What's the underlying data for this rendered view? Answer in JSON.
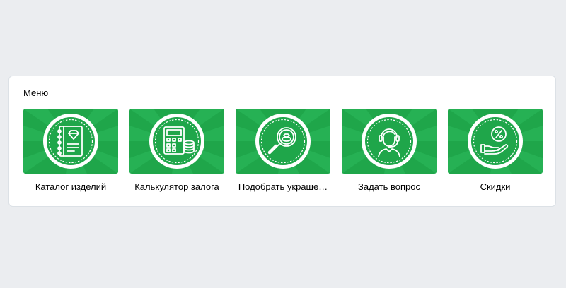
{
  "menu": {
    "title": "Меню",
    "accent_color": "#1fa64a",
    "items": [
      {
        "label": "Каталог изделий",
        "icon": "catalog-book-diamond-icon"
      },
      {
        "label": "Калькулятор залога",
        "icon": "calculator-coins-icon"
      },
      {
        "label": "Подобрать украше…",
        "icon": "magnifier-ring-icon"
      },
      {
        "label": "Задать вопрос",
        "icon": "support-operator-icon"
      },
      {
        "label": "Скидки",
        "icon": "discount-hand-icon"
      }
    ]
  }
}
